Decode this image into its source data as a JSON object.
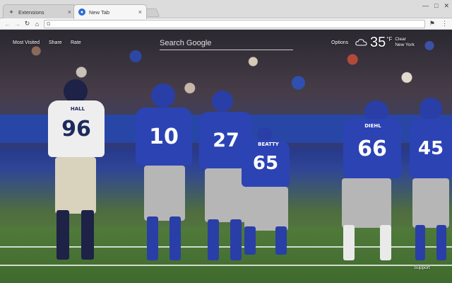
{
  "browser": {
    "tabs": [
      {
        "title": "Extensions",
        "icon": "puzzle-icon",
        "active": false
      },
      {
        "title": "New Tab",
        "icon": "chrome-icon",
        "active": true
      }
    ],
    "omnibox": {
      "value": "",
      "icon": "google-g-icon"
    }
  },
  "overlay": {
    "nav_links": [
      "Most Visited",
      "Share",
      "Rate"
    ],
    "search_placeholder": "Search Google",
    "options_label": "Options",
    "weather": {
      "icon": "cloud-icon",
      "temp": "35",
      "unit": "°F",
      "condition": "Clear",
      "location": "New York"
    },
    "support_label": "Support"
  },
  "background": {
    "jersey_numbers": [
      "96",
      "10",
      "27",
      "65",
      "66",
      "45"
    ],
    "nameplates": [
      "HALL",
      "BEATTY",
      "DIEHL"
    ],
    "colors": {
      "giants_blue": "#2c43b4",
      "rams_white": "#eeeeee",
      "field_green": "#4f7a3a"
    }
  }
}
